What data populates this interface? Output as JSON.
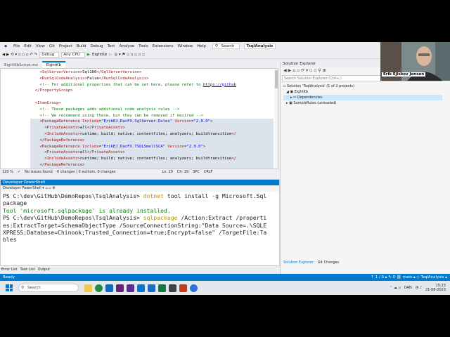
{
  "menu": {
    "items": [
      "File",
      "Edit",
      "View",
      "Git",
      "Project",
      "Build",
      "Debug",
      "Test",
      "Analyze",
      "Tools",
      "Extensions",
      "Window",
      "Help"
    ],
    "search": "Search",
    "solution": "TsqlAnalysis"
  },
  "toolbar": {
    "config": "Debug",
    "platform": "Any CPU",
    "run_target": "EightKb"
  },
  "editor": {
    "tab_active": "EightKb",
    "tab_other": "EightKbScript.md",
    "status": {
      "zoom": "120 %",
      "issues": "No issues found",
      "changes": "0 changes | 0 authors, 0 changes",
      "line": "Ln: 20",
      "col": "Ch: 29",
      "spc": "SPC",
      "crlf": "CRLF"
    }
  },
  "powershell": {
    "title": "Developer PowerShell",
    "tab": "Developer PowerShell",
    "l1_prompt": "PS C:\\dev\\GitHub\\DemoRepos\\TsqlAnalysis> ",
    "l1_cmd": "dotnet",
    "l1_args": " tool install -g Microsoft.Sql",
    "l2": "package",
    "l3": "Tool 'microsoft.sqlpackage' is already installed.",
    "l4_prompt": "PS C:\\dev\\GitHub\\DemoRepos\\TsqlAnalysis> ",
    "l4_cmd": "sqlpackage",
    "l4_args": " /Action:Extract /properti",
    "l5": "es:ExtractTarget=SchemaObjectType /SourceConnectionString:\"Data Source=.\\SQLE",
    "l6": "XPRESS;Database=Chinook;Trusted_Connection=true;Encrypt=false\" /TargetFile:Ta",
    "l7": "bles"
  },
  "bottom_tabs": [
    "Error List",
    "Task List",
    "Output"
  ],
  "solution_explorer": {
    "title": "Solution Explorer",
    "search": "Search Solution Explorer (Ctrl+;)",
    "tree": [
      "Solution 'TsqlAnalysis' (1 of 2 projects)",
      "EightKb",
      "Dependencies",
      "SampleRules (unloaded)"
    ],
    "tabs": [
      "Solution Explorer",
      "Git Changes"
    ]
  },
  "status_bar": {
    "left": "Ready",
    "right": "↑ 1 / 0 ▴   ✎ 0   ⛓ main ▴   ◇ TsqlAnalysis ▴"
  },
  "taskbar": {
    "search": "Search",
    "lang": "DAN",
    "time": "15:23",
    "date": "21-08-2023"
  },
  "webcam": {
    "name": "Erik Ejlskov Jensen"
  },
  "colors": {
    "accent": "#007acc",
    "taskbar": "#e3e8ef"
  }
}
